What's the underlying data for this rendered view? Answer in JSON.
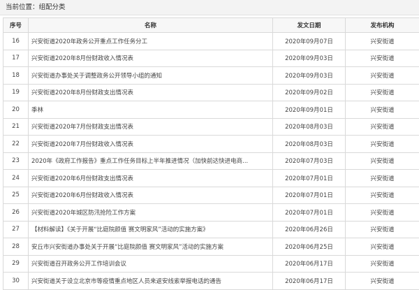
{
  "breadcrumb": {
    "text": "当前位置：组配分类"
  },
  "table": {
    "headers": [
      "序号",
      "名称",
      "发文日期",
      "发布机构"
    ],
    "rows": [
      {
        "no": "16",
        "title": "兴安街道2020年政务公开重点工作任务分工",
        "date": "2020年09月07日",
        "org": "兴安街道"
      },
      {
        "no": "17",
        "title": "兴安街道2020年8月份财政收入情况表",
        "date": "2020年09月03日",
        "org": "兴安街道"
      },
      {
        "no": "18",
        "title": "兴安街道办事处关于调整政务公开领导小组的通知",
        "date": "2020年09月03日",
        "org": "兴安街道"
      },
      {
        "no": "19",
        "title": "兴安街道2020年8月份财政支出情况表",
        "date": "2020年09月02日",
        "org": "兴安街道"
      },
      {
        "no": "20",
        "title": "季林",
        "date": "2020年09月01日",
        "org": "兴安街道"
      },
      {
        "no": "21",
        "title": "兴安街道2020年7月份财政支出情况表",
        "date": "2020年08月03日",
        "org": "兴安街道"
      },
      {
        "no": "22",
        "title": "兴安街道2020年7月份财政收入情况表",
        "date": "2020年08月03日",
        "org": "兴安街道"
      },
      {
        "no": "23",
        "title": "2020年《政府工作报告》重点工作任务目标上半年推进情况（加快前达快进电商...",
        "date": "2020年07月03日",
        "org": "兴安街道"
      },
      {
        "no": "24",
        "title": "兴安街道2020年6月份财政支出情况表",
        "date": "2020年07月01日",
        "org": "兴安街道"
      },
      {
        "no": "25",
        "title": "兴安街道2020年6月份财政收入情况表",
        "date": "2020年07月01日",
        "org": "兴安街道"
      },
      {
        "no": "26",
        "title": "兴安街道2020年城区防汛抢险工作方案",
        "date": "2020年07月01日",
        "org": "兴安街道"
      },
      {
        "no": "27",
        "title": "【材料解读】《关于开展“比庭院颜值 赛文明家风”活动的实施方案》",
        "date": "2020年06月26日",
        "org": "兴安街道"
      },
      {
        "no": "28",
        "title": "安丘市兴安街道办事处关于开展“比庭院颜值 赛文明家风”活动的实施方案",
        "date": "2020年06月25日",
        "org": "兴安街道"
      },
      {
        "no": "29",
        "title": "兴安街道召开政务公开工作培训会议",
        "date": "2020年06月17日",
        "org": "兴安街道"
      },
      {
        "no": "30",
        "title": "兴安街道关于设立北京市等疫情重点地区人员来返安线索举报电话的通告",
        "date": "2020年06月17日",
        "org": "兴安街道"
      }
    ]
  }
}
